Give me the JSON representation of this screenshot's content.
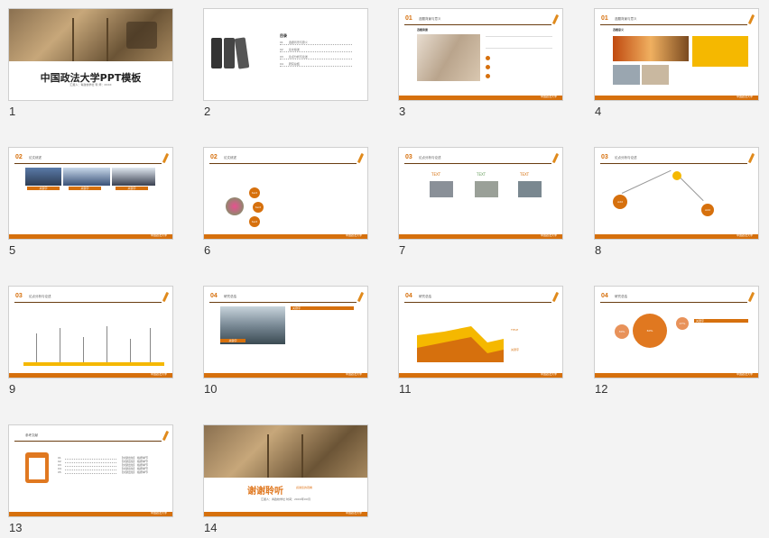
{
  "slides": [
    {
      "num": "1",
      "title": "中国政法大学PPT模板",
      "subtitle": "汇报人：青政校学社      导  师：XXXX",
      "footer": ""
    },
    {
      "num": "2",
      "heading": "目录",
      "toc": [
        {
          "n": "01",
          "t": "选题背景与意义"
        },
        {
          "n": "02",
          "t": "论文综述"
        },
        {
          "n": "03",
          "t": "论点分析与论述"
        },
        {
          "n": "04",
          "t": "研究总结"
        }
      ]
    },
    {
      "num": "3",
      "pnum": "01",
      "ptitle": "选题背景与意义",
      "sub": "选题背景"
    },
    {
      "num": "4",
      "pnum": "01",
      "ptitle": "选题背景与意义",
      "sub": "选题意义"
    },
    {
      "num": "5",
      "pnum": "02",
      "ptitle": "论文综述",
      "labels": [
        "关键字",
        "关键字",
        "关键字"
      ]
    },
    {
      "num": "6",
      "pnum": "02",
      "ptitle": "论文综述",
      "bubbles": [
        "text",
        "text",
        "text"
      ]
    },
    {
      "num": "7",
      "pnum": "03",
      "ptitle": "论点分析与论述",
      "cols": [
        "TEXT",
        "TEXT",
        "TEXT"
      ],
      "side": "Add your text"
    },
    {
      "num": "8",
      "pnum": "03",
      "ptitle": "论点分析与论述",
      "nodes": [
        "Add",
        "Add"
      ]
    },
    {
      "num": "9",
      "pnum": "03",
      "ptitle": "论点分析与论述"
    },
    {
      "num": "10",
      "pnum": "04",
      "ptitle": "研究总结",
      "tag1": "关键字",
      "tag2": "关键字"
    },
    {
      "num": "11",
      "pnum": "04",
      "ptitle": "研究总结",
      "legend": [
        "TITLE",
        "关键字"
      ]
    },
    {
      "num": "12",
      "pnum": "04",
      "ptitle": "研究总结",
      "circles": [
        "30%",
        "60%",
        "27%"
      ],
      "tag": "关键字"
    },
    {
      "num": "13",
      "ptitle": "参考文献",
      "refs": [
        "01",
        "02",
        "03",
        "04",
        "05"
      ],
      "reftext": "【文献出处】  格按举节"
    },
    {
      "num": "14",
      "title": "谢谢聆听",
      "subtitle": "汇报人：青政校学社      时间：20XX年XX月",
      "right": "感谢您的观看"
    }
  ],
  "footer_text": "中国政法大学",
  "colors": {
    "accent": "#d6700d",
    "dark": "#6a3d10",
    "yellow": "#f5b800"
  }
}
